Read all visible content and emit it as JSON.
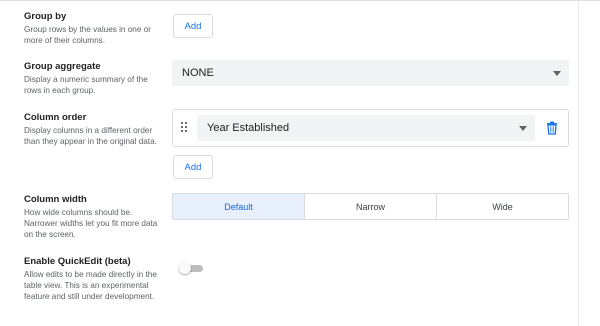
{
  "group_by": {
    "title": "Group by",
    "description": "Group rows by the values in one or more of their columns.",
    "add_label": "Add"
  },
  "group_aggregate": {
    "title": "Group aggregate",
    "description": "Display a numeric summary of the rows in each group.",
    "selected": "NONE"
  },
  "column_order": {
    "title": "Column order",
    "description": "Display columns in a different order than they appear in the original data.",
    "items": [
      {
        "selected": "Year Established"
      }
    ],
    "add_label": "Add"
  },
  "column_width": {
    "title": "Column width",
    "description": "How wide columns should be. Narrower widths let you fit more data on the screen.",
    "options": [
      "Default",
      "Narrow",
      "Wide"
    ],
    "selected": "Default"
  },
  "quick_edit": {
    "title": "Enable QuickEdit (beta)",
    "description": "Allow edits to be made directly in the table view. This is an experimental feature and still under development.",
    "enabled": false
  }
}
